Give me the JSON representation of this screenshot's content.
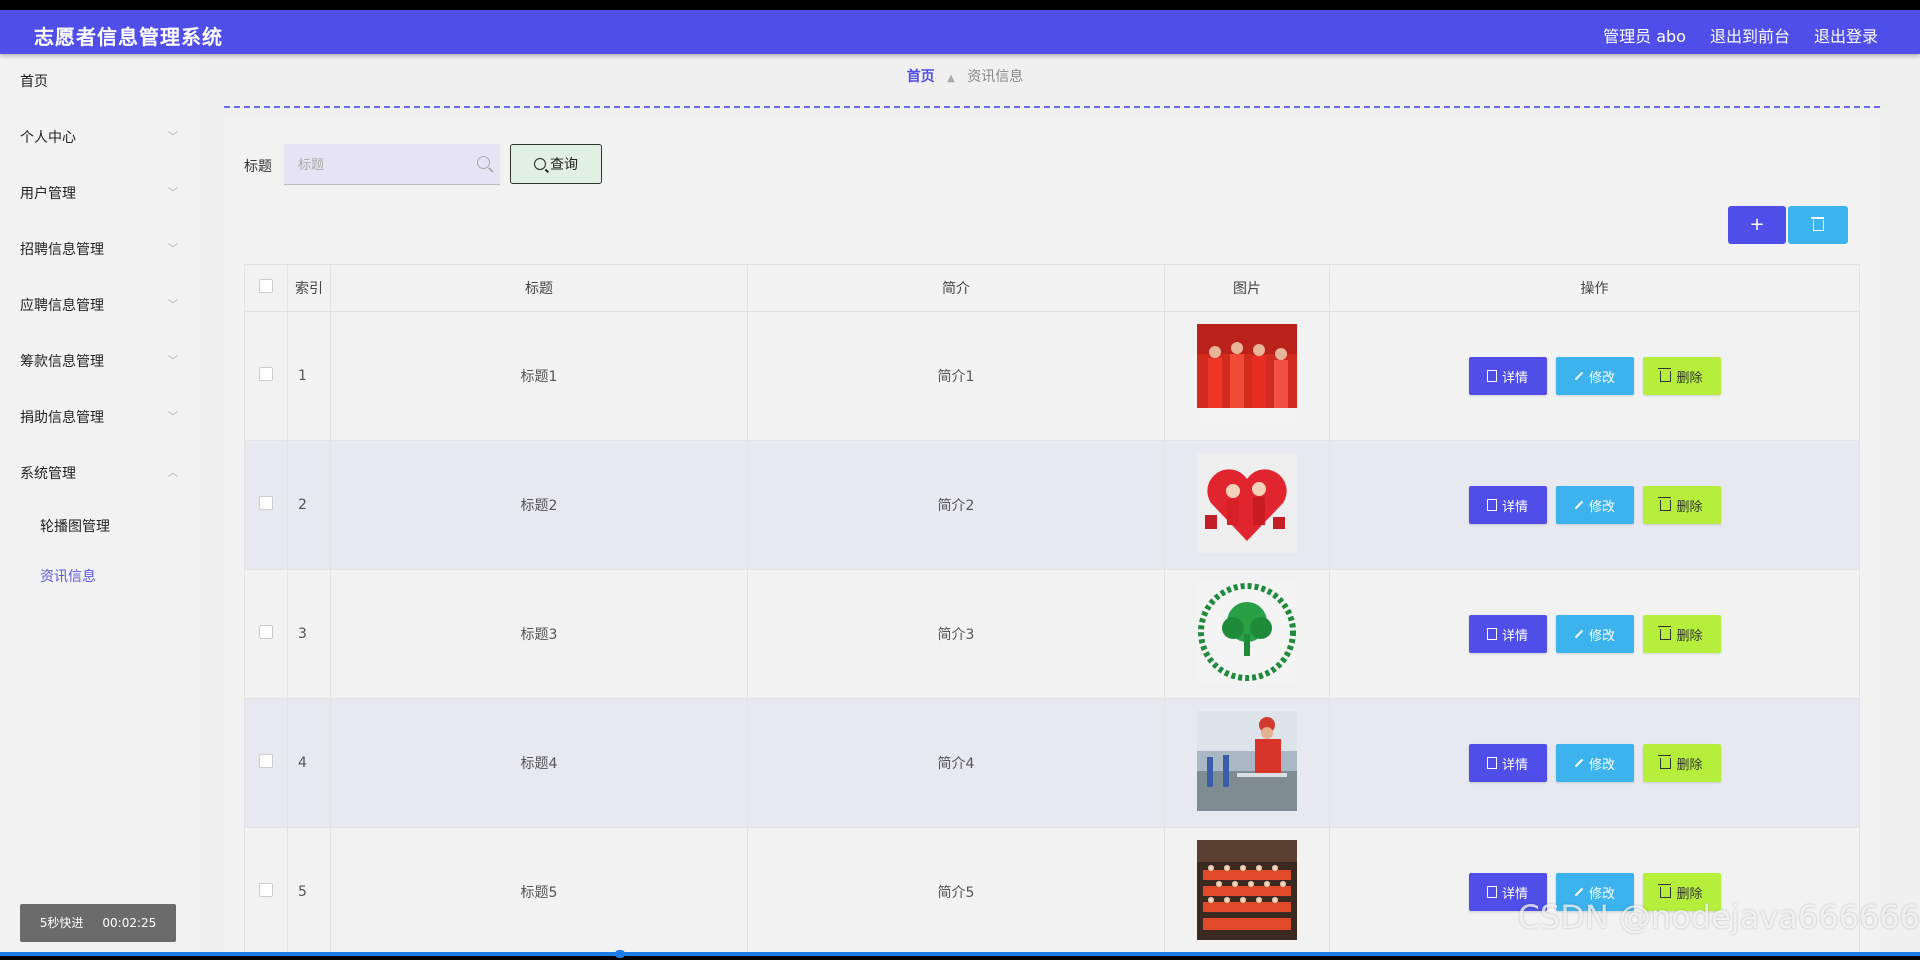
{
  "header": {
    "app_title": "志愿者信息管理系统",
    "admin_label": "管理员 abo",
    "to_front_label": "退出到前台",
    "logout_label": "退出登录"
  },
  "sidebar": {
    "items": [
      {
        "label": "首页"
      },
      {
        "label": "个人中心"
      },
      {
        "label": "用户管理"
      },
      {
        "label": "招聘信息管理"
      },
      {
        "label": "应聘信息管理"
      },
      {
        "label": "筹款信息管理"
      },
      {
        "label": "捐助信息管理"
      },
      {
        "label": "系统管理"
      }
    ],
    "sub_items": [
      {
        "label": "轮播图管理"
      },
      {
        "label": "资讯信息"
      }
    ]
  },
  "player": {
    "fast_forward_label": "5秒快进",
    "time": "00:02:25"
  },
  "breadcrumb": {
    "home": "首页",
    "current": "资讯信息"
  },
  "search": {
    "label": "标题",
    "placeholder": "标题",
    "value": "",
    "query_button": "查询"
  },
  "toolbar": {
    "add_label": "+"
  },
  "table": {
    "columns": [
      "索引",
      "标题",
      "简介",
      "图片",
      "操作"
    ],
    "rows": [
      {
        "index": "1",
        "title": "标题1",
        "intro": "简介1"
      },
      {
        "index": "2",
        "title": "标题2",
        "intro": "简介2"
      },
      {
        "index": "3",
        "title": "标题3",
        "intro": "简介3"
      },
      {
        "index": "4",
        "title": "标题4",
        "intro": "简介4"
      },
      {
        "index": "5",
        "title": "标题5",
        "intro": "简介5"
      }
    ],
    "actions": {
      "detail": "详情",
      "edit": "修改",
      "delete": "删除"
    }
  },
  "watermark": "CSDN @nodejava666666",
  "colors": {
    "primary": "#4f4ee8",
    "info": "#3db3ee",
    "lime": "#b6ee3c"
  }
}
